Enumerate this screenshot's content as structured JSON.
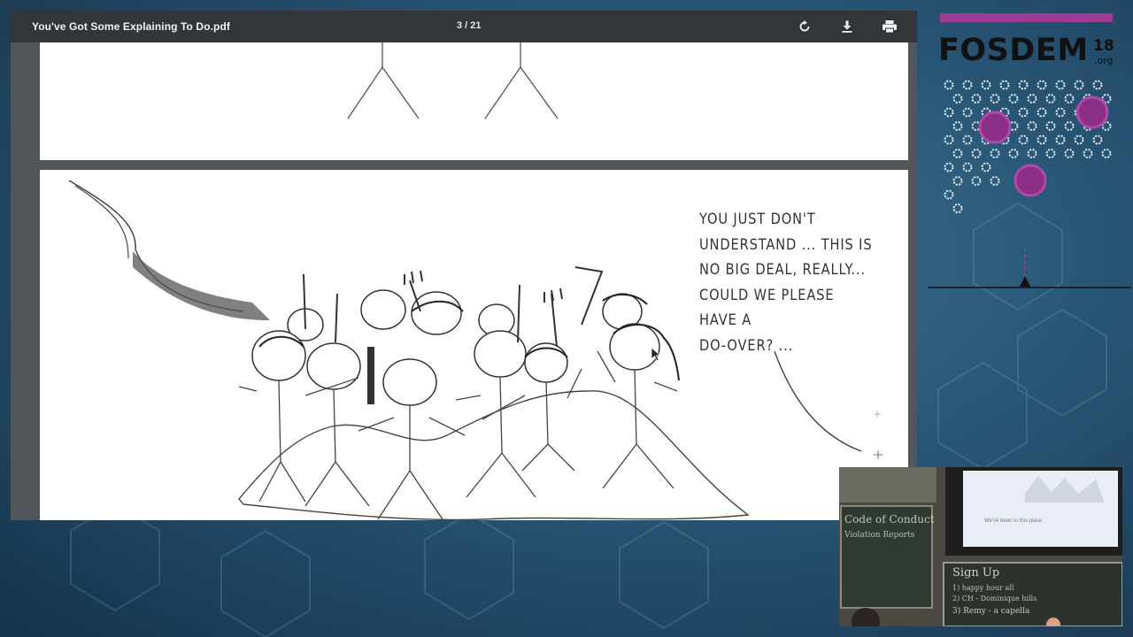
{
  "viewer": {
    "file_title": "You've Got Some Explaining To Do.pdf",
    "page_indicator": "3 / 21",
    "icons": {
      "rotate": "rotate-icon",
      "download": "download-icon",
      "print": "print-icon"
    }
  },
  "slide": {
    "speech_lines": [
      "YOU JUST DON'T",
      "UNDERSTAND ... THIS IS",
      "NO BIG DEAL, REALLY...",
      "COULD WE PLEASE HAVE A",
      "DO-OVER? ..."
    ]
  },
  "branding": {
    "name": "FOSDEM",
    "year": "18",
    "tld": ".org",
    "accent": "#9b3b92"
  },
  "camera": {
    "board_title": "Code of Conduct",
    "board_subtitle": "Violation Reports",
    "screen_caption": "We've been to this place",
    "chalkboard_title": "Sign Up",
    "chalkboard_lines": [
      "1) happy hour all",
      "2) CH - Dominique hills",
      "3) Remy - a capella"
    ]
  },
  "colors": {
    "toolbar_bg": "#323639",
    "viewer_bg": "#525659",
    "fosdem_purple": "#9b3b92"
  }
}
